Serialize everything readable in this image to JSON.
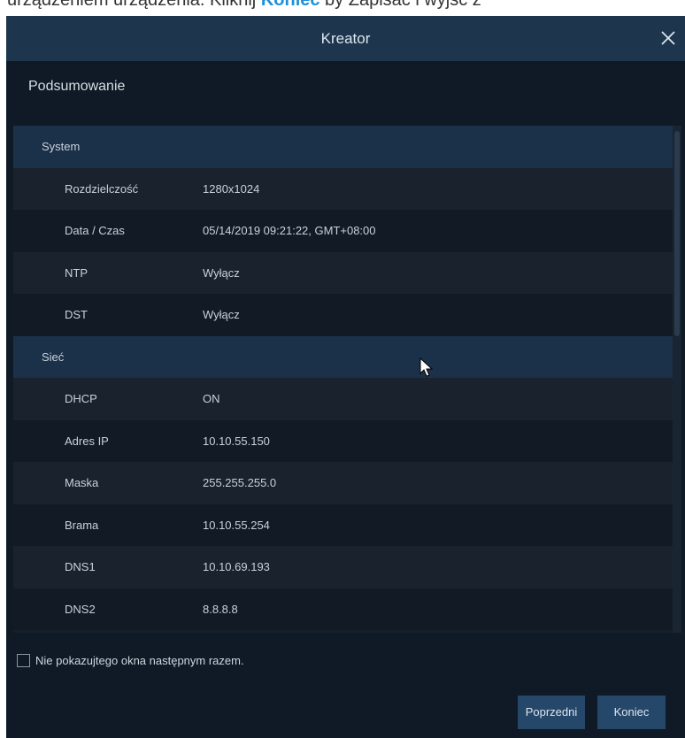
{
  "background_doc": {
    "text_before": "urządzeniem urządzenia. Kliknij ",
    "text_link": "Koniec",
    "text_after": " by Zapisać i wyjść z "
  },
  "dialog": {
    "title": "Kreator",
    "heading": "Podsumowanie"
  },
  "summary": {
    "groups": [
      {
        "label": "System",
        "rows": [
          {
            "label": "Rozdzielczość",
            "value": "1280x1024"
          },
          {
            "label": "Data / Czas",
            "value": "05/14/2019 09:21:22, GMT+08:00"
          },
          {
            "label": "NTP",
            "value": "Wyłącz"
          },
          {
            "label": "DST",
            "value": "Wyłącz"
          }
        ]
      },
      {
        "label": "Sieć",
        "rows": [
          {
            "label": "DHCP",
            "value": "ON"
          },
          {
            "label": "Adres IP",
            "value": "10.10.55.150"
          },
          {
            "label": "Maska",
            "value": "255.255.255.0"
          },
          {
            "label": "Brama",
            "value": "10.10.55.254"
          },
          {
            "label": "DNS1",
            "value": "10.10.69.193"
          },
          {
            "label": "DNS2",
            "value": "8.8.8.8"
          }
        ]
      }
    ]
  },
  "dont_show": {
    "label": "Nie pokazujtego okna następnym razem.",
    "checked": false
  },
  "buttons": {
    "previous": "Poprzedni",
    "finish": "Koniec"
  },
  "colors": {
    "dialog_bg": "#0f1a26",
    "title_bar": "#1d364d",
    "group_row": "#1b3149",
    "button": "#25476a",
    "doc_link": "#1e90d8"
  }
}
